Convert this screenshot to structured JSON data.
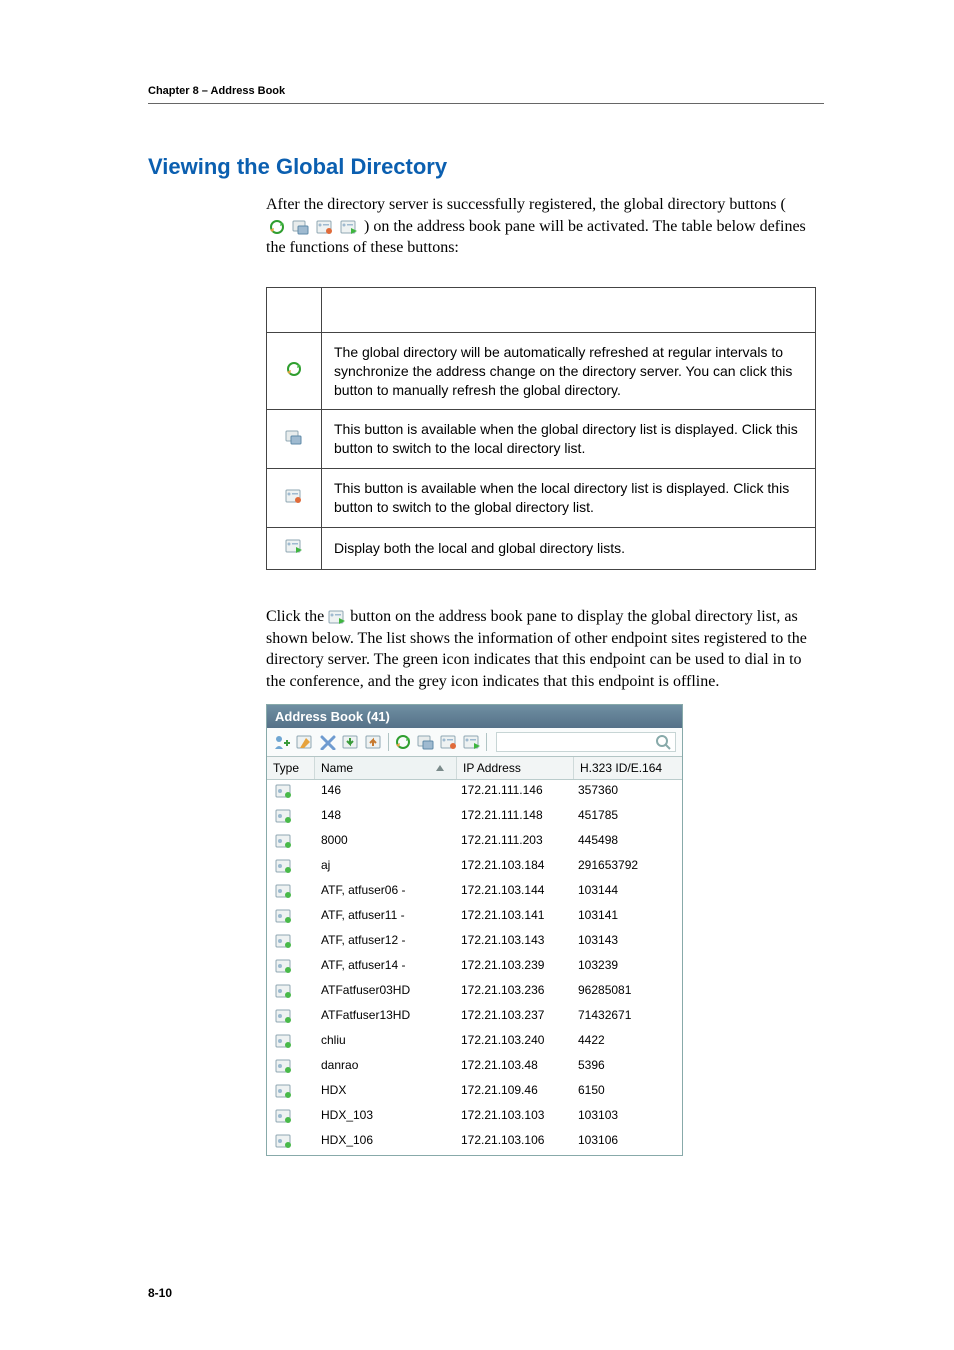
{
  "header": {
    "chapter": "Chapter 8 – Address Book"
  },
  "section": {
    "title": "Viewing the Global Directory",
    "p1a": "After the directory server is successfully registered, the global directory buttons (",
    "p1b": ") on the address book pane will be activated. The table below defines the functions of these buttons:",
    "p2a": "Click the ",
    "p2b": " button on the address book pane to display the global directory list, as shown below. The list shows the information of other endpoint sites registered to the directory server. The green icon indicates that this endpoint can be used to dial in to the conference, and the grey icon indicates that this endpoint is offline."
  },
  "func_table": [
    "The global directory will be automatically refreshed at regular intervals to synchronize the address change on the directory server. You can click this button to manually refresh the global directory.",
    "This button is available when the global directory list is displayed. Click this button to switch to the local directory list.",
    "This button is available when the local directory list is displayed. Click this button to switch to the global directory list.",
    "Display both the local and global directory lists."
  ],
  "icon_names": {
    "refresh": "refresh-icon",
    "local": "switch-local-icon",
    "global": "switch-global-icon",
    "both": "show-both-icon",
    "endpoint": "endpoint-icon"
  },
  "addr_book": {
    "title": "Address Book (41)",
    "columns": {
      "type": "Type",
      "name": "Name",
      "ip": "IP Address",
      "ext": "H.323 ID/E.164"
    },
    "rows": [
      {
        "name": "146",
        "ip": "172.21.111.146",
        "ext": "357360"
      },
      {
        "name": "148",
        "ip": "172.21.111.148",
        "ext": "451785"
      },
      {
        "name": "8000",
        "ip": "172.21.111.203",
        "ext": "445498"
      },
      {
        "name": "aj",
        "ip": "172.21.103.184",
        "ext": "291653792"
      },
      {
        "name": "ATF, atfuser06 -",
        "ip": "172.21.103.144",
        "ext": "103144"
      },
      {
        "name": "ATF, atfuser11 -",
        "ip": "172.21.103.141",
        "ext": "103141"
      },
      {
        "name": "ATF, atfuser12 -",
        "ip": "172.21.103.143",
        "ext": "103143"
      },
      {
        "name": "ATF, atfuser14 -",
        "ip": "172.21.103.239",
        "ext": "103239"
      },
      {
        "name": "ATFatfuser03HD",
        "ip": "172.21.103.236",
        "ext": "96285081"
      },
      {
        "name": "ATFatfuser13HD",
        "ip": "172.21.103.237",
        "ext": "71432671"
      },
      {
        "name": "chliu",
        "ip": "172.21.103.240",
        "ext": "4422"
      },
      {
        "name": "danrao",
        "ip": "172.21.103.48",
        "ext": "5396"
      },
      {
        "name": "HDX",
        "ip": "172.21.109.46",
        "ext": "6150"
      },
      {
        "name": "HDX_103",
        "ip": "172.21.103.103",
        "ext": "103103"
      },
      {
        "name": "HDX_106",
        "ip": "172.21.103.106",
        "ext": "103106"
      }
    ]
  },
  "page_number": "8-10"
}
